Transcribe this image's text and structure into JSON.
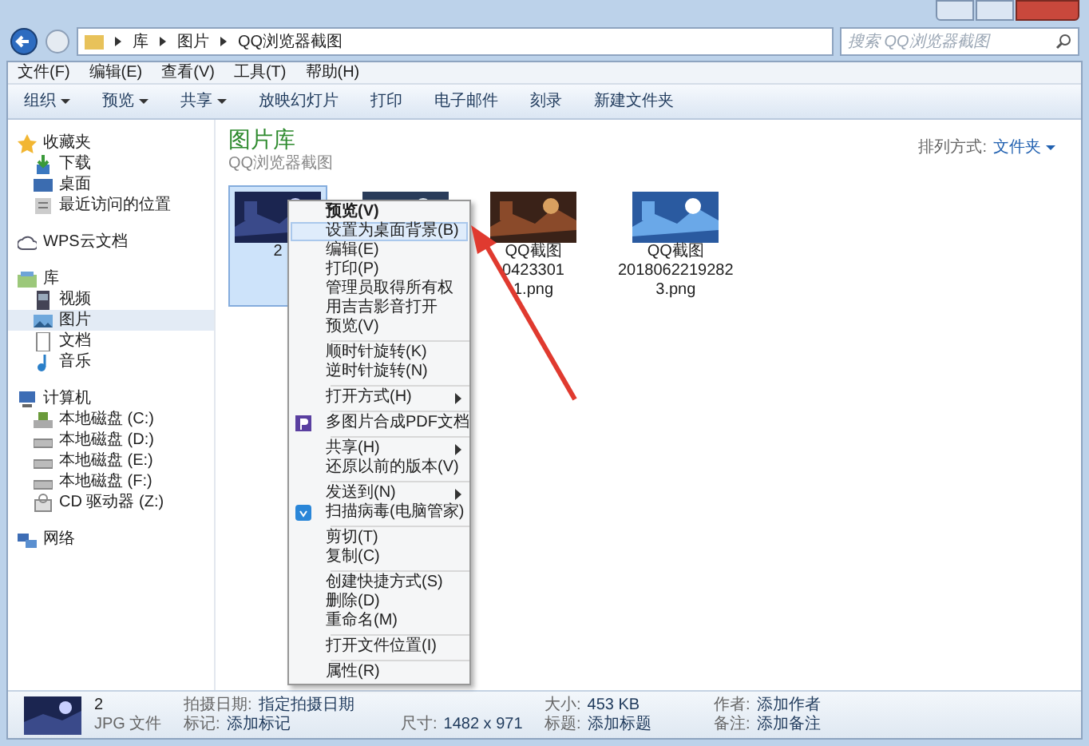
{
  "address": {
    "crumbs": [
      "库",
      "图片",
      "QQ浏览器截图"
    ],
    "search_placeholder": "搜索 QQ浏览器截图"
  },
  "menubar": [
    "文件(F)",
    "编辑(E)",
    "查看(V)",
    "工具(T)",
    "帮助(H)"
  ],
  "toolbar": [
    {
      "label": "组织",
      "dropdown": true
    },
    {
      "label": "预览",
      "dropdown": true
    },
    {
      "label": "共享",
      "dropdown": true
    },
    {
      "label": "放映幻灯片",
      "dropdown": false
    },
    {
      "label": "打印",
      "dropdown": false
    },
    {
      "label": "电子邮件",
      "dropdown": false
    },
    {
      "label": "刻录",
      "dropdown": false
    },
    {
      "label": "新建文件夹",
      "dropdown": false
    }
  ],
  "sidebar": [
    {
      "label": "收藏夹",
      "selected": false,
      "children": [
        {
          "label": "下载",
          "selected": false
        },
        {
          "label": "桌面",
          "selected": false
        },
        {
          "label": "最近访问的位置",
          "selected": false
        }
      ]
    },
    {
      "label": "WPS云文档",
      "selected": false
    },
    {
      "label": "库",
      "selected": false,
      "children": [
        {
          "label": "视频",
          "selected": false
        },
        {
          "label": "图片",
          "selected": true
        },
        {
          "label": "文档",
          "selected": false
        },
        {
          "label": "音乐",
          "selected": false
        }
      ]
    },
    {
      "label": "计算机",
      "selected": false,
      "children": [
        {
          "label": "本地磁盘 (C:)",
          "selected": false
        },
        {
          "label": "本地磁盘 (D:)",
          "selected": false
        },
        {
          "label": "本地磁盘 (E:)",
          "selected": false
        },
        {
          "label": "本地磁盘 (F:)",
          "selected": false
        },
        {
          "label": "CD 驱动器 (Z:)",
          "selected": false
        }
      ]
    },
    {
      "label": "网络",
      "selected": false
    }
  ],
  "library": {
    "title": "图片库",
    "subtitle": "QQ浏览器截图",
    "arrange_label": "排列方式:",
    "arrange_value": "文件夹"
  },
  "files": [
    {
      "lines": [
        "2"
      ],
      "selected": true
    },
    {
      "selected": false
    },
    {
      "lines": [
        "QQ截图",
        "0423301",
        "1.png"
      ],
      "selected": false
    },
    {
      "lines": [
        "QQ截图",
        "2018062219282",
        "3.png"
      ],
      "selected": false
    }
  ],
  "context_menu": [
    {
      "kind": "item",
      "label": "预览(V)",
      "bold": true,
      "selected": false
    },
    {
      "kind": "item",
      "label": "设置为桌面背景(B)",
      "bold": false,
      "selected": true
    },
    {
      "kind": "item",
      "label": "编辑(E)",
      "bold": false,
      "selected": false
    },
    {
      "kind": "item",
      "label": "打印(P)",
      "bold": false,
      "selected": false
    },
    {
      "kind": "item",
      "label": "管理员取得所有权",
      "bold": false,
      "selected": false
    },
    {
      "kind": "item",
      "label": "用吉吉影音打开",
      "bold": false,
      "selected": false
    },
    {
      "kind": "item",
      "label": "预览(V)",
      "bold": false,
      "selected": false
    },
    {
      "kind": "separator"
    },
    {
      "kind": "item",
      "label": "顺时针旋转(K)",
      "bold": false,
      "selected": false
    },
    {
      "kind": "item",
      "label": "逆时针旋转(N)",
      "bold": false,
      "selected": false
    },
    {
      "kind": "separator"
    },
    {
      "kind": "item",
      "label": "打开方式(H)",
      "bold": false,
      "selected": false,
      "submenu": true
    },
    {
      "kind": "separator"
    },
    {
      "kind": "pdf_item",
      "label": "多图片合成PDF文档",
      "bold": false,
      "selected": false
    },
    {
      "kind": "separator"
    },
    {
      "kind": "item",
      "label": "共享(H)",
      "bold": false,
      "selected": false,
      "submenu": true
    },
    {
      "kind": "item",
      "label": "还原以前的版本(V)",
      "bold": false,
      "selected": false
    },
    {
      "kind": "separator"
    },
    {
      "kind": "item",
      "label": "发送到(N)",
      "bold": false,
      "selected": false,
      "submenu": true
    },
    {
      "kind": "scan_item",
      "label": "扫描病毒(电脑管家)",
      "bold": false,
      "selected": false
    },
    {
      "kind": "separator"
    },
    {
      "kind": "item",
      "label": "剪切(T)",
      "bold": false,
      "selected": false
    },
    {
      "kind": "item",
      "label": "复制(C)",
      "bold": false,
      "selected": false
    },
    {
      "kind": "separator"
    },
    {
      "kind": "item",
      "label": "创建快捷方式(S)",
      "bold": false,
      "selected": false
    },
    {
      "kind": "item",
      "label": "删除(D)",
      "bold": false,
      "selected": false
    },
    {
      "kind": "item",
      "label": "重命名(M)",
      "bold": false,
      "selected": false
    },
    {
      "kind": "separator"
    },
    {
      "kind": "item",
      "label": "打开文件位置(I)",
      "bold": false,
      "selected": false
    },
    {
      "kind": "separator"
    },
    {
      "kind": "item",
      "label": "属性(R)",
      "bold": false,
      "selected": false
    }
  ],
  "details": {
    "name": "2",
    "type": "JPG 文件",
    "columns": [
      [
        {
          "label": "拍摄日期:",
          "value": "指定拍摄日期"
        },
        {
          "label": "标记:",
          "value": "添加标记"
        }
      ],
      [
        {
          "label": "尺寸:",
          "value": "1482 x 971"
        }
      ],
      [
        {
          "label": "大小:",
          "value": "453 KB"
        },
        {
          "label": "标题:",
          "value": "添加标题"
        }
      ],
      [
        {
          "label": "作者:",
          "value": "添加作者"
        },
        {
          "label": "备注:",
          "value": "添加备注"
        }
      ]
    ]
  }
}
